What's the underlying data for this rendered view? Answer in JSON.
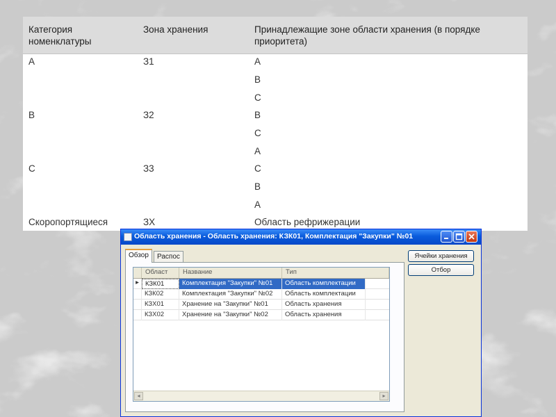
{
  "slide_table": {
    "headers": [
      "Категория номенклатуры",
      "Зона хранения",
      "Принадлежащие зоне области хранения (в порядке приоритета)"
    ],
    "rows": [
      {
        "category": "A",
        "zone": "З1",
        "areas": [
          "A",
          "B",
          "C"
        ]
      },
      {
        "category": "B",
        "zone": "З2",
        "areas": [
          "B",
          "C",
          "A"
        ]
      },
      {
        "category": "C",
        "zone": "З3",
        "areas": [
          "C",
          "B",
          "A"
        ]
      },
      {
        "category": "Скоропортящиеся",
        "zone": "ЗХ",
        "areas": [
          "Область рефрижерации"
        ]
      }
    ]
  },
  "dialog": {
    "title": "Область хранения - Область хранения: КЗК01, Комплектация \"Закупки\" №01",
    "tabs": [
      {
        "label": "Обзор",
        "active": true
      },
      {
        "label": "Распос",
        "active": false
      }
    ],
    "grid": {
      "columns": [
        "Област",
        "Название",
        "Тип"
      ],
      "rows": [
        {
          "code": "КЗК01",
          "name": "Комплектация \"Закупки\" №01",
          "type": "Область комплектации",
          "selected": true,
          "indicator": "▸"
        },
        {
          "code": "КЗК02",
          "name": "Комплектация \"Закупки\" №02",
          "type": "Область комплектации",
          "selected": false,
          "indicator": ""
        },
        {
          "code": "КЗХ01",
          "name": "Хранение на \"Закупки\" №01",
          "type": "Область хранения",
          "selected": false,
          "indicator": ""
        },
        {
          "code": "КЗХ02",
          "name": "Хранение на \"Закупки\" №02",
          "type": "Область хранения",
          "selected": false,
          "indicator": ""
        }
      ]
    },
    "buttons": {
      "storage_zones": "Ячейки хранения",
      "filter": "Отбор"
    }
  },
  "colors": {
    "titlebar": "#0a5bdc",
    "selection": "#316ac5",
    "table_header": "#dcdcdc",
    "active_tab": "#e7a03d",
    "close_button": "#c3380f"
  },
  "icons": [
    "window-icon",
    "minimize-icon",
    "maximize-icon",
    "close-icon",
    "row-indicator-icon",
    "scroll-left-icon",
    "scroll-right-icon"
  ]
}
